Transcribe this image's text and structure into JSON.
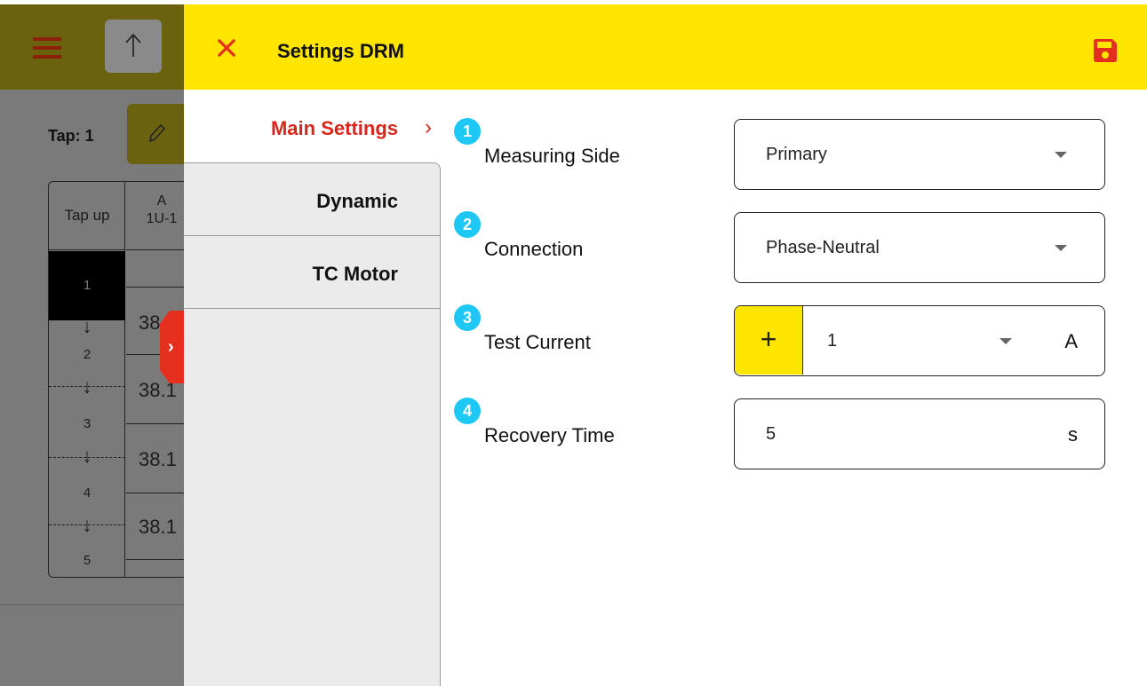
{
  "background": {
    "tap_label": "Tap: 1",
    "table": {
      "col1_header": "Tap up",
      "col2_header": [
        "A",
        "1U-1"
      ],
      "tap_numbers": [
        "1",
        "2",
        "3",
        "4",
        "5"
      ],
      "cell_values": [
        "38",
        "38.1",
        "38.1",
        "38.1"
      ]
    }
  },
  "header": {
    "title": "Settings DRM",
    "close_icon": "close-icon",
    "save_icon": "save-icon",
    "accent_color": "#ffe500",
    "danger_color": "#e5301f"
  },
  "nav": {
    "active": {
      "label": "Main Settings",
      "chevron": "›"
    },
    "items": [
      {
        "label": "Dynamic"
      },
      {
        "label": "TC Motor"
      }
    ]
  },
  "settings": [
    {
      "index": "1",
      "label": "Measuring Side",
      "value": "Primary",
      "type": "dropdown"
    },
    {
      "index": "2",
      "label": "Connection",
      "value": "Phase-Neutral",
      "type": "dropdown"
    },
    {
      "index": "3",
      "label": "Test Current",
      "value": "1",
      "unit": "A",
      "type": "dropdown-with-plus",
      "plus_label": "+"
    },
    {
      "index": "4",
      "label": "Recovery Time",
      "value": "5",
      "unit": "s",
      "type": "number"
    }
  ]
}
